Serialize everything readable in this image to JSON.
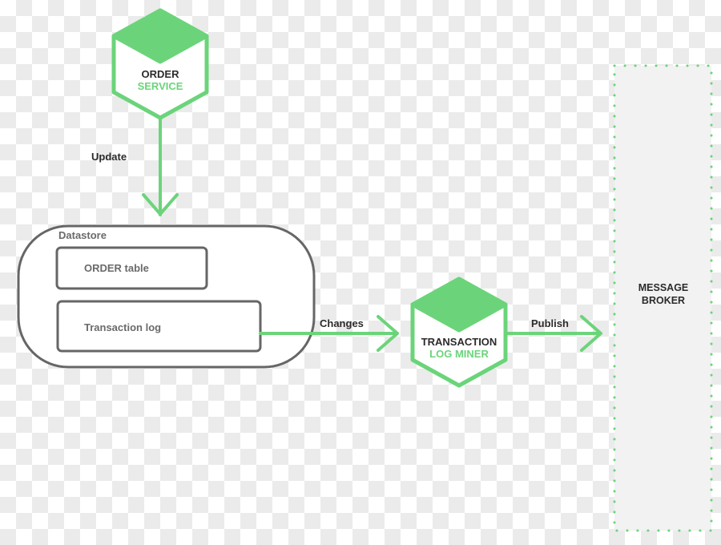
{
  "colors": {
    "accent": "#6bd47a",
    "outline": "#666666",
    "broker_fill": "#f2f2f2"
  },
  "order_service": {
    "line1": "ORDER",
    "line2": "SERVICE"
  },
  "update_label": "Update",
  "datastore": {
    "title": "Datastore",
    "order_table": "ORDER table",
    "transaction_log": "Transaction log"
  },
  "changes_label": "Changes",
  "miner": {
    "line1": "TRANSACTION",
    "line2": "LOG MINER"
  },
  "publish_label": "Publish",
  "broker": {
    "line1": "MESSAGE",
    "line2": "BROKER"
  }
}
